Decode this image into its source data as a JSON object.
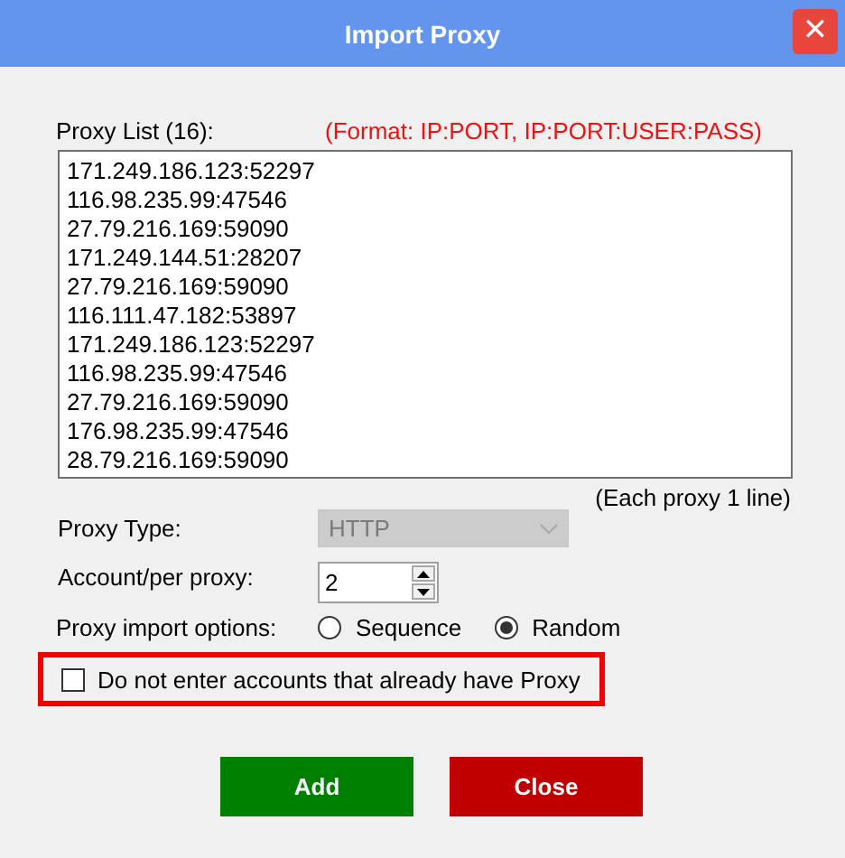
{
  "window": {
    "title": "Import Proxy",
    "close": "✕"
  },
  "proxy_list": {
    "label": "Proxy List (16):",
    "format_hint": "(Format: IP:PORT, IP:PORT:USER:PASS)",
    "lines": [
      "171.249.186.123:52297",
      "116.98.235.99:47546",
      "27.79.216.169:59090",
      "171.249.144.51:28207",
      "27.79.216.169:59090",
      "116.111.47.182:53897",
      "171.249.186.123:52297",
      "116.98.235.99:47546",
      "27.79.216.169:59090",
      "176.98.235.99:47546",
      "28.79.216.169:59090"
    ],
    "line_hint": "(Each proxy 1 line)"
  },
  "proxy_type": {
    "label": "Proxy Type:",
    "value": "HTTP",
    "disabled": true
  },
  "account_per_proxy": {
    "label": "Account/per proxy:",
    "value": "2"
  },
  "import_options": {
    "label": "Proxy import options:",
    "options": [
      {
        "label": "Sequence",
        "selected": false
      },
      {
        "label": "Random",
        "selected": true
      }
    ]
  },
  "skip_existing": {
    "label": "Do not enter accounts that already have Proxy",
    "checked": false,
    "highlighted": true
  },
  "buttons": [
    {
      "label": "Add",
      "kind": "confirm"
    },
    {
      "label": "Close",
      "kind": "cancel"
    }
  ]
}
